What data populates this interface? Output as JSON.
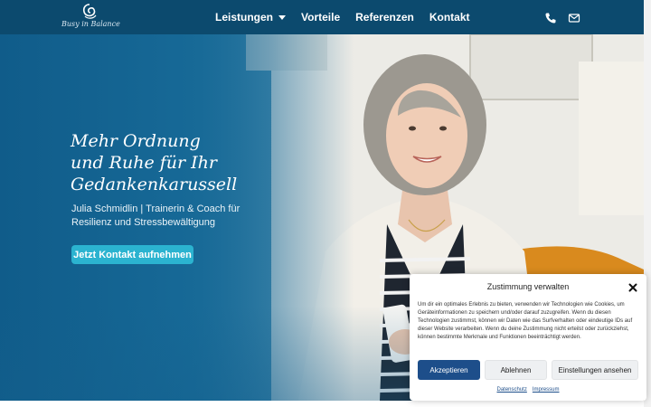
{
  "brand": {
    "logo_text": "Busy in Balance"
  },
  "nav": {
    "items": [
      {
        "label": "Leistungen",
        "has_dropdown": true
      },
      {
        "label": "Vorteile",
        "has_dropdown": false
      },
      {
        "label": "Referenzen",
        "has_dropdown": false
      },
      {
        "label": "Kontakt",
        "has_dropdown": false
      }
    ],
    "icons": [
      "phone-icon",
      "email-icon"
    ]
  },
  "hero": {
    "headline": [
      "Mehr Ordnung",
      "und Ruhe für Ihr",
      "Gedankenkarussell"
    ],
    "subline": [
      "Julia Schmidlin | Trainerin & Coach für",
      "Resilienz und Stressbewältigung"
    ],
    "cta_label": "Jetzt Kontakt aufnehmen"
  },
  "consent": {
    "title": "Zustimmung verwalten",
    "body": "Um dir ein optimales Erlebnis zu bieten, verwenden wir Technologien wie Cookies, um Geräteinformationen zu speichern und/oder darauf zuzugreifen. Wenn du diesen Technologien zustimmst, können wir Daten wie das Surfverhalten oder eindeutige IDs auf dieser Website verarbeiten. Wenn du deine Zustimmung nicht erteilst oder zurückziehst, können bestimmte Merkmale und Funktionen beeinträchtigt werden.",
    "accept_label": "Akzeptieren",
    "deny_label": "Ablehnen",
    "settings_label": "Einstellungen ansehen",
    "links": [
      "Datenschutz",
      "Impressum"
    ]
  },
  "colors": {
    "header_bg": "#0c4a6e",
    "cta_bg": "#2bb3d0",
    "accept_bg": "#1d4e8a"
  }
}
